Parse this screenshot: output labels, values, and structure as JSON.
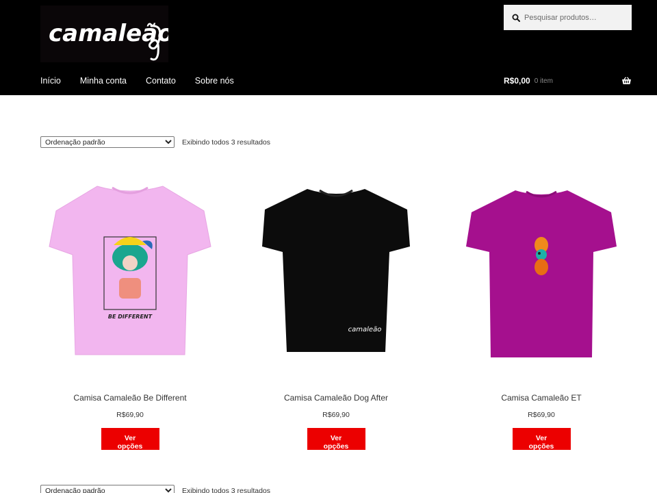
{
  "header": {
    "logo_text": "camaleão",
    "search": {
      "placeholder": "Pesquisar produtos…"
    },
    "nav": [
      {
        "label": "Início"
      },
      {
        "label": "Minha conta"
      },
      {
        "label": "Contato"
      },
      {
        "label": "Sobre nós"
      }
    ],
    "cart": {
      "amount": "R$0,00",
      "count": "0 item"
    }
  },
  "toolbar": {
    "sort_selected": "Ordenação padrão",
    "result_count": "Exibindo todos 3 resultados"
  },
  "products": [
    {
      "title": "Camisa Camaleão Be Different",
      "price": "R$69,90",
      "button": "Ver opções",
      "shirt_color": "#f2b6ef",
      "print_text": "BE DIFFERENT"
    },
    {
      "title": "Camisa Camaleão Dog After",
      "price": "R$69,90",
      "button": "Ver opções",
      "shirt_color": "#0c0c0c",
      "print_text": "camaleão"
    },
    {
      "title": "Camisa Camaleão ET",
      "price": "R$69,90",
      "button": "Ver opções",
      "shirt_color": "#a5108e"
    }
  ],
  "colors": {
    "header_bg": "#000000",
    "button_bg": "#ec0000",
    "search_bg": "#f2f2f2"
  }
}
